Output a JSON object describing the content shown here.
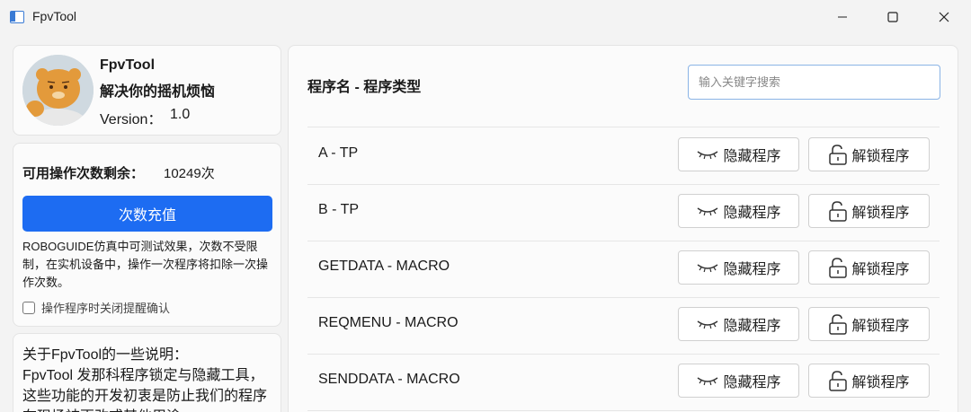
{
  "window": {
    "title": "FpvTool"
  },
  "profile": {
    "name": "FpvTool",
    "tagline": "解决你的摇机烦恼",
    "version_label": "Version：",
    "version": "1.0"
  },
  "usage": {
    "label": "可用操作次数剩余：",
    "count": "10249次",
    "recharge_label": "次数充值",
    "note": "ROBOGUIDE仿真中可测试效果，次数不受限制，在实机设备中，操作一次程序将扣除一次操作次数。",
    "checkbox_label": "操作程序时关闭提醒确认",
    "checkbox_checked": false
  },
  "about": {
    "title": "关于FpvTool的一些说明：",
    "body": "FpvTool 发那科程序锁定与隐藏工具，这些功能的开发初衷是防止我们的程序在现场被更改或其他用途"
  },
  "main": {
    "header": "程序名 - 程序类型",
    "search_placeholder": "输入关键字搜索",
    "hide_label": "隐藏程序",
    "unlock_label": "解锁程序",
    "programs": [
      {
        "name": "A  - TP"
      },
      {
        "name": "B  - TP"
      },
      {
        "name": "GETDATA  - MACRO"
      },
      {
        "name": "REQMENU  - MACRO"
      },
      {
        "name": "SENDDATA  - MACRO"
      }
    ]
  },
  "icons": {
    "hide": "eye-closed-icon",
    "unlock": "unlock-icon"
  }
}
